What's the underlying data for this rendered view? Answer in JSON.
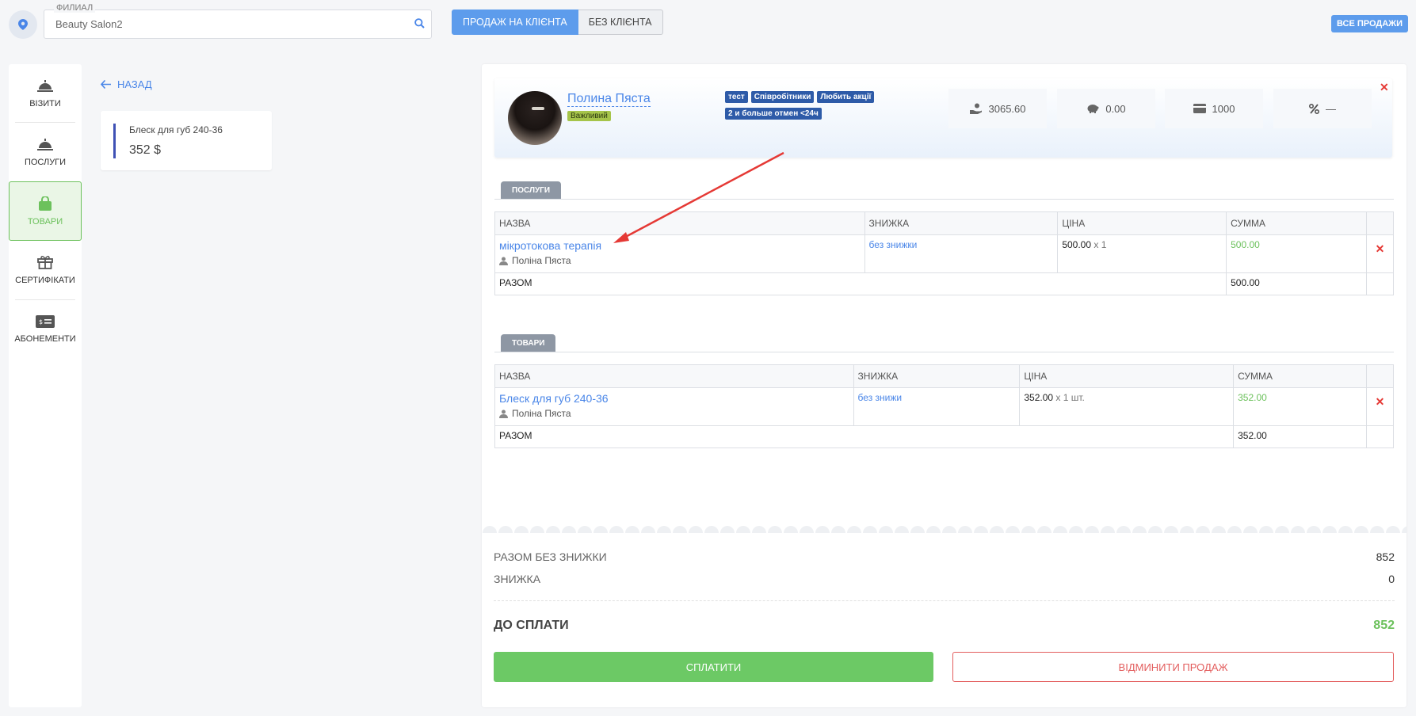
{
  "header": {
    "branch_label": "ФИЛИАЛ",
    "branch_value": "Beauty Salon2",
    "mode_client": "ПРОДАЖ НА КЛІЄНТА",
    "mode_no_client": "БЕЗ КЛІЄНТА",
    "all_sales": "ВСЕ ПРОДАЖИ"
  },
  "nav": [
    {
      "label": "ВІЗИТИ",
      "icon": "service-bell-icon"
    },
    {
      "label": "ПОСЛУГИ",
      "icon": "service-bell-icon"
    },
    {
      "label": "ТОВАРИ",
      "icon": "shopping-bag-icon",
      "active": true
    },
    {
      "label": "СЕРТИФІКАТИ",
      "icon": "gift-icon"
    },
    {
      "label": "АБОНЕМЕНТИ",
      "icon": "ticket-icon"
    }
  ],
  "back": {
    "label": "НАЗАД"
  },
  "product_card": {
    "name": "Блеск для губ 240-36",
    "price": "352 $"
  },
  "client": {
    "name": "Полина Пяста",
    "badge": "Важливий",
    "tags": [
      "тест",
      "Співробітники",
      "Любить акції",
      "2 и больше отмен <24ч"
    ],
    "stats": [
      "3065.60",
      "0.00",
      "1000",
      "—"
    ]
  },
  "services": {
    "tab": "ПОСЛУГИ",
    "headers": [
      "НАЗВА",
      "ЗНИЖКА",
      "ЦІНА",
      "СУММА"
    ],
    "row": {
      "name": "мікротокова терапія",
      "employee": "Поліна Пяста",
      "discount": "без знижки",
      "price": "500.00",
      "qty": "x 1",
      "sum": "500.00"
    },
    "total_label": "РАЗОМ",
    "total": "500.00"
  },
  "products": {
    "tab": "ТОВАРИ",
    "headers": [
      "НАЗВА",
      "ЗНИЖКА",
      "ЦІНА",
      "СУММА"
    ],
    "row": {
      "name": "Блеск для губ 240-36",
      "employee": "Поліна Пяста",
      "discount": "без знижи",
      "price": "352.00",
      "qty": "x 1 шт.",
      "sum": "352.00"
    },
    "total_label": "РАЗОМ",
    "total": "352.00"
  },
  "totals": {
    "without_discount_label": "РАЗОМ БЕЗ ЗНИЖКИ",
    "without_discount": "852",
    "discount_label": "ЗНИЖКА",
    "discount": "0",
    "to_pay_label": "ДО СПЛАТИ",
    "to_pay": "852"
  },
  "actions": {
    "pay": "СПЛАТИТИ",
    "cancel": "ВІДМИНИТИ ПРОДАЖ"
  },
  "colors": {
    "accent": "#5d9cec",
    "success": "#6cc15c",
    "danger": "#e53935",
    "tag": "#2e5ba8"
  }
}
